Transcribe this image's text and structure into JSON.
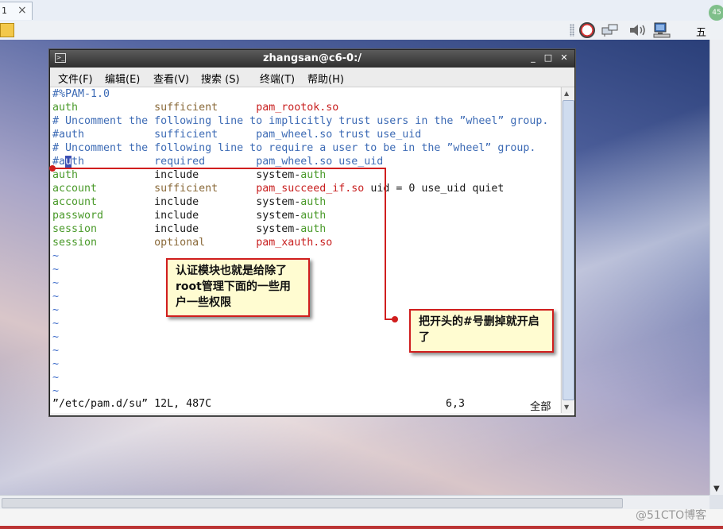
{
  "host": {
    "tab_number": "1",
    "tab_close": "×",
    "week_label": "五",
    "badge": "45",
    "watermark": "@51CTO博客"
  },
  "icons": {
    "toolbar_left": "folder-pencil-icon",
    "gauge": "gauge-icon",
    "network": "network-icon",
    "speaker": "speaker-icon",
    "monitor": "monitor-icon"
  },
  "terminal": {
    "title": "zhangsan@c6-0:/",
    "menu": [
      "文件(F)",
      "编辑(E)",
      "查看(V)",
      "搜索 (S)",
      "终端(T)",
      "帮助(H)"
    ],
    "lines": [
      {
        "type": "comment",
        "text": "#%PAM-1.0"
      },
      {
        "type": "rule",
        "module_type": "auth",
        "control": "sufficient",
        "control_style": "olive",
        "module": "pam_rootok.so",
        "module_style": "red",
        "args": ""
      },
      {
        "type": "comment",
        "text": "# Uncomment the following line to implicitly trust users in the ”wheel” group."
      },
      {
        "type": "comment",
        "text": "#auth           sufficient      pam_wheel.so trust use_uid"
      },
      {
        "type": "comment",
        "text": "# Uncomment the following line to require a user to be in the ”wheel” group."
      },
      {
        "type": "cursorline",
        "prefix": "#a",
        "cursor": "u",
        "rest": "th           required        pam_wheel.so use_uid"
      },
      {
        "type": "rule",
        "module_type": "auth",
        "control": "include",
        "control_style": "black",
        "module": "system-",
        "module_suffix": "auth",
        "module_style": "black",
        "args": ""
      },
      {
        "type": "rule",
        "module_type": "account",
        "control": "sufficient",
        "control_style": "olive",
        "module": "pam_succeed_if.so",
        "module_style": "red",
        "args": " uid = 0 use_uid quiet"
      },
      {
        "type": "rule",
        "module_type": "account",
        "control": "include",
        "control_style": "black",
        "module": "system-",
        "module_suffix": "auth",
        "module_style": "black",
        "args": ""
      },
      {
        "type": "rule",
        "module_type": "password",
        "control": "include",
        "control_style": "black",
        "module": "system-",
        "module_suffix": "auth",
        "module_style": "black",
        "args": ""
      },
      {
        "type": "rule",
        "module_type": "session",
        "control": "include",
        "control_style": "black",
        "module": "system-",
        "module_suffix": "auth",
        "module_style": "black",
        "args": ""
      },
      {
        "type": "rule",
        "module_type": "session",
        "control": "optional",
        "control_style": "olive",
        "module": "pam_xauth.so",
        "module_style": "red",
        "args": ""
      },
      {
        "type": "tilde",
        "text": "~"
      },
      {
        "type": "tilde",
        "text": "~"
      },
      {
        "type": "tilde",
        "text": "~"
      },
      {
        "type": "tilde",
        "text": "~"
      },
      {
        "type": "tilde",
        "text": "~"
      },
      {
        "type": "tilde",
        "text": "~"
      },
      {
        "type": "tilde",
        "text": "~"
      },
      {
        "type": "tilde",
        "text": "~"
      },
      {
        "type": "tilde",
        "text": "~"
      },
      {
        "type": "tilde",
        "text": "~"
      },
      {
        "type": "tilde",
        "text": "~"
      }
    ],
    "status": {
      "file": "”/etc/pam.d/su” 12L, 487C",
      "position": "6,3",
      "all": "全部"
    }
  },
  "annotations": {
    "auth_note": "认证模块也就是给除了root管理下面的一些用户一些权限",
    "uncomment_note": "把开头的#号删掉就开启了"
  },
  "colors": {
    "comment": "#3d6bb5",
    "type": "#4a9a2a",
    "module": "#c81f1f",
    "annotation_border": "#d01e1e",
    "annotation_bg": "#fffcd1"
  }
}
